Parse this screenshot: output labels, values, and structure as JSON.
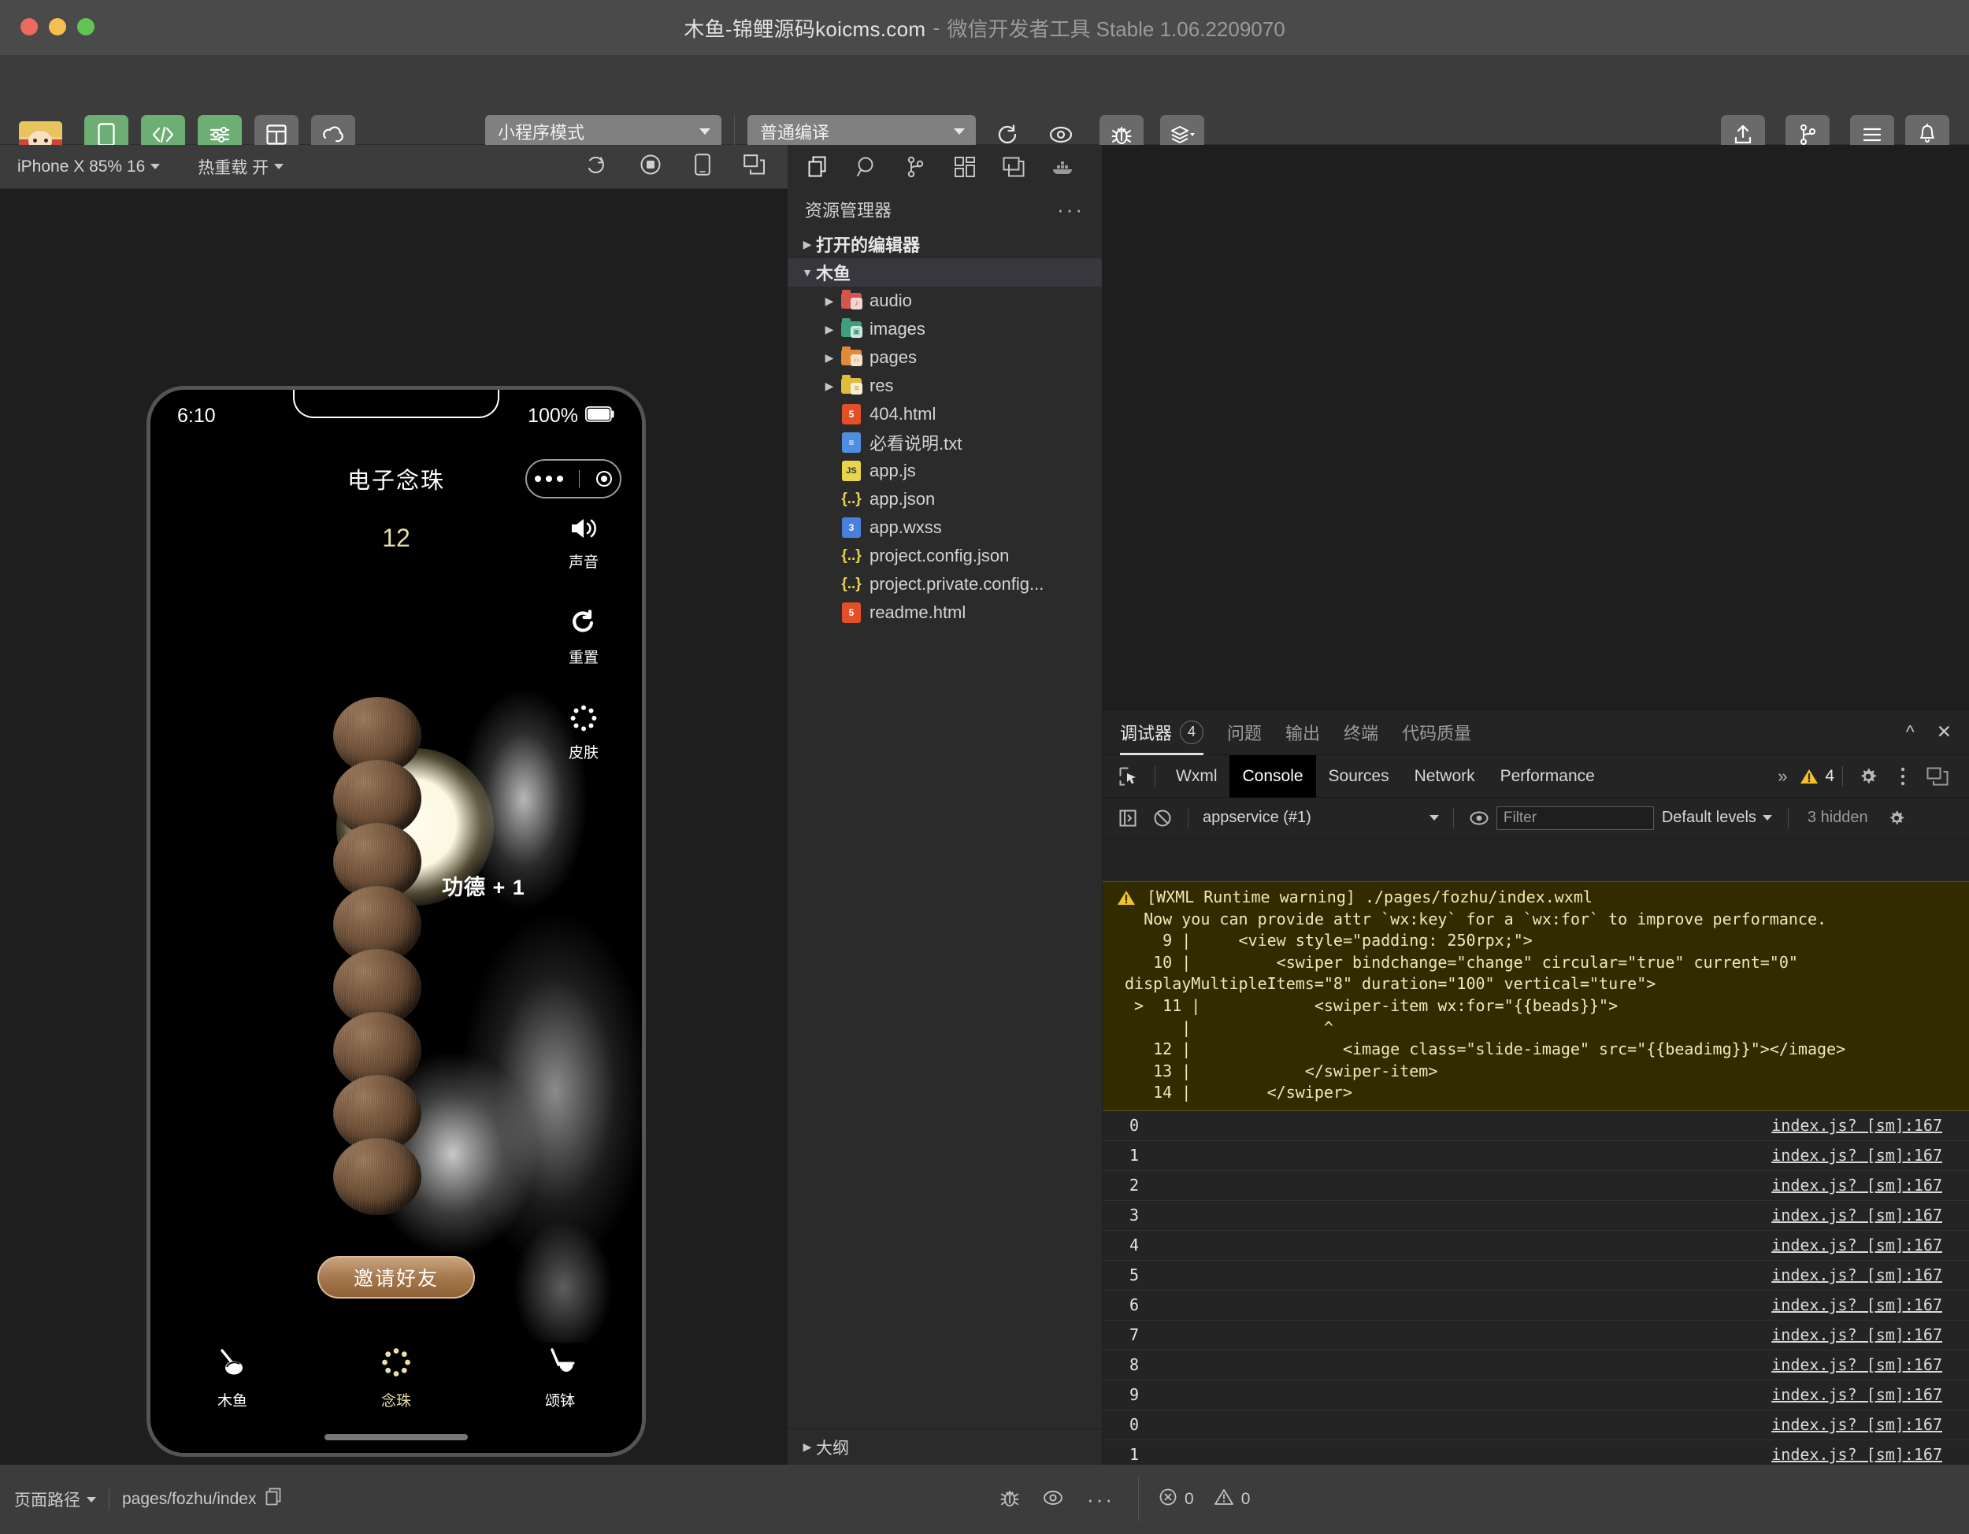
{
  "titlebar": {
    "project": "木鱼-锦鲤源码koicms.com",
    "dash": "-",
    "app": "微信开发者工具 Stable 1.06.2209070"
  },
  "toolbar": {
    "left_buttons": [
      {
        "label": "模拟器",
        "icon": "phone-icon",
        "green": true
      },
      {
        "label": "编辑器",
        "icon": "code-icon",
        "green": true
      },
      {
        "label": "调试器",
        "icon": "sliders-icon",
        "green": true
      },
      {
        "label": "可视化",
        "icon": "layout-icon",
        "green": false
      },
      {
        "label": "云开发",
        "icon": "cloud-icon",
        "green": false
      }
    ],
    "mode_select": "小程序模式",
    "compile_select": "普通编译",
    "mid_buttons": [
      {
        "label": "编译",
        "icon": "refresh-icon"
      },
      {
        "label": "预览",
        "icon": "eye-icon"
      },
      {
        "label": "真机调试",
        "icon": "bug-icon"
      },
      {
        "label": "清缓存",
        "icon": "layers-icon"
      }
    ],
    "right_buttons": [
      {
        "label": "上传",
        "icon": "upload-icon"
      },
      {
        "label": "版本管理",
        "icon": "branch-icon"
      },
      {
        "label": "详情",
        "icon": "menu-icon"
      },
      {
        "label": "消息",
        "icon": "bell-icon"
      }
    ]
  },
  "simulator": {
    "device_select": "iPhone X 85% 16",
    "hotreload_select": "热重载 开",
    "icons": [
      "refresh-icon",
      "record-icon",
      "device-icon",
      "window-icon"
    ],
    "phone": {
      "status_time": "6:10",
      "battery_pct": "100%",
      "nav_title": "电子念珠",
      "counter": "12",
      "merit_text": "功德 + 1",
      "side_actions": [
        {
          "label": "声音",
          "icon": "speaker-icon"
        },
        {
          "label": "重置",
          "icon": "reset-icon"
        },
        {
          "label": "皮肤",
          "icon": "beads-ring-icon"
        }
      ],
      "invite_button": "邀请好友",
      "tabs": [
        {
          "label": "木鱼",
          "icon": "woodfish-icon",
          "active": false
        },
        {
          "label": "念珠",
          "icon": "beads-ring-icon",
          "active": true
        },
        {
          "label": "颂钵",
          "icon": "singing-bowl-icon",
          "active": false
        }
      ],
      "bead_count": 8
    }
  },
  "explorer": {
    "activity_icons": [
      "files-icon",
      "search-icon",
      "source-control-icon",
      "extensions-icon",
      "cloud-storage-icon",
      "docker-icon"
    ],
    "header_title": "资源管理器",
    "header_more": "···",
    "tree": [
      {
        "label": "打开的编辑器",
        "type": "section",
        "expanded": false,
        "indent": 0
      },
      {
        "label": "木鱼",
        "type": "section",
        "expanded": true,
        "indent": 0,
        "highlight": true
      },
      {
        "label": "audio",
        "type": "folder",
        "color": "#d4564a",
        "indent": 1,
        "expanded": false
      },
      {
        "label": "images",
        "type": "folder",
        "color": "#3f9e7e",
        "indent": 1,
        "expanded": false
      },
      {
        "label": "pages",
        "type": "folder",
        "color": "#e08a3c",
        "indent": 1,
        "expanded": false
      },
      {
        "label": "res",
        "type": "folder",
        "color": "#e0bb3c",
        "indent": 1,
        "expanded": false
      },
      {
        "label": "404.html",
        "type": "file",
        "kind": "html",
        "indent": 1
      },
      {
        "label": "必看说明.txt",
        "type": "file",
        "kind": "txt",
        "indent": 1
      },
      {
        "label": "app.js",
        "type": "file",
        "kind": "js",
        "indent": 1
      },
      {
        "label": "app.json",
        "type": "file",
        "kind": "json",
        "indent": 1
      },
      {
        "label": "app.wxss",
        "type": "file",
        "kind": "css",
        "indent": 1
      },
      {
        "label": "project.config.json",
        "type": "file",
        "kind": "json",
        "indent": 1
      },
      {
        "label": "project.private.config...",
        "type": "file",
        "kind": "json",
        "indent": 1
      },
      {
        "label": "readme.html",
        "type": "file",
        "kind": "html",
        "indent": 1
      }
    ],
    "outline_label": "大纲"
  },
  "debugger": {
    "tabs": [
      {
        "label": "调试器",
        "badge": "4",
        "active": true
      },
      {
        "label": "问题",
        "badge": "",
        "active": false
      },
      {
        "label": "输出",
        "badge": "",
        "active": false
      },
      {
        "label": "终端",
        "badge": "",
        "active": false
      },
      {
        "label": "代码质量",
        "badge": "",
        "active": false
      }
    ],
    "window_controls": [
      "^",
      "✕"
    ],
    "devtools_tabs": [
      {
        "label": "Wxml",
        "active": false
      },
      {
        "label": "Console",
        "active": true
      },
      {
        "label": "Sources",
        "active": false
      },
      {
        "label": "Network",
        "active": false
      },
      {
        "label": "Performance",
        "active": false
      }
    ],
    "overflow": "»",
    "warning_count": "4",
    "console_toolbar": {
      "context": "appservice (#1)",
      "filter_placeholder": "Filter",
      "levels": "Default levels",
      "hidden": "3 hidden"
    },
    "warning": {
      "title": "[WXML Runtime warning] ./pages/fozhu/index.wxml",
      "body": "  Now you can provide attr `wx:key` for a `wx:for` to improve performance.\n    9 |     <view style=\"padding: 250rpx;\">\n   10 |         <swiper bindchange=\"change\" circular=\"true\" current=\"0\" displayMultipleItems=\"8\" duration=\"100\" vertical=\"ture\">\n >  11 |            <swiper-item wx:for=\"{{beads}}\">\n      |              ^\n   12 |                <image class=\"slide-image\" src=\"{{beadimg}}\"></image>\n   13 |            </swiper-item>\n   14 |        </swiper>"
    },
    "logs": [
      {
        "value": "0",
        "source": "index.js? [sm]:167"
      },
      {
        "value": "1",
        "source": "index.js? [sm]:167"
      },
      {
        "value": "2",
        "source": "index.js? [sm]:167"
      },
      {
        "value": "3",
        "source": "index.js? [sm]:167"
      },
      {
        "value": "4",
        "source": "index.js? [sm]:167"
      },
      {
        "value": "5",
        "source": "index.js? [sm]:167"
      },
      {
        "value": "6",
        "source": "index.js? [sm]:167"
      },
      {
        "value": "7",
        "source": "index.js? [sm]:167"
      },
      {
        "value": "8",
        "source": "index.js? [sm]:167"
      },
      {
        "value": "9",
        "source": "index.js? [sm]:167"
      },
      {
        "value": "0",
        "source": "index.js? [sm]:167"
      },
      {
        "value": "1",
        "source": "index.js? [sm]:167"
      }
    ],
    "prompt": "❯"
  },
  "statusbar": {
    "page_path_label": "页面路径",
    "page_path_value": "pages/fozhu/index",
    "error_count": "0",
    "warn_count": "0"
  },
  "colors": {
    "accent_green": "#6cae73",
    "warning_bg": "#332b00",
    "warning_text": "#f0e6b8",
    "bead_gold": "#e9dfa7"
  }
}
